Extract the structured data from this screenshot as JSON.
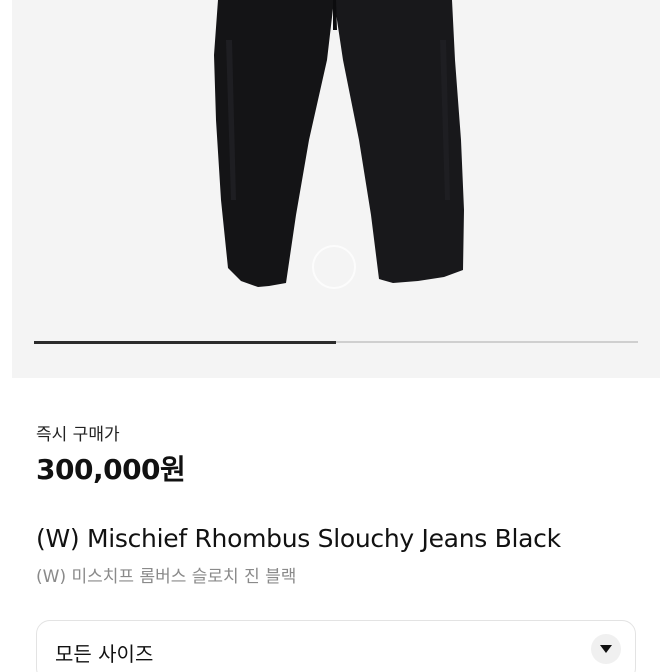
{
  "gallery": {
    "image_icon": "black-slouchy-jeans-product-photo",
    "slide_progress": 0.5
  },
  "product": {
    "price_label": "즉시 구매가",
    "price": "300,000원",
    "title_en": "(W) Mischief Rhombus Slouchy Jeans Black",
    "title_ko": "(W) 미스치프 롬버스 슬로치 진 블랙"
  },
  "size_selector": {
    "label": "모든 사이즈",
    "icon": "chevron-down-icon"
  },
  "colors": {
    "gallery_bg": "#f4f4f4",
    "jeans": "#141416",
    "progress_fill": "#2b2b2b",
    "subtitle_gray": "#8a8a8a"
  }
}
